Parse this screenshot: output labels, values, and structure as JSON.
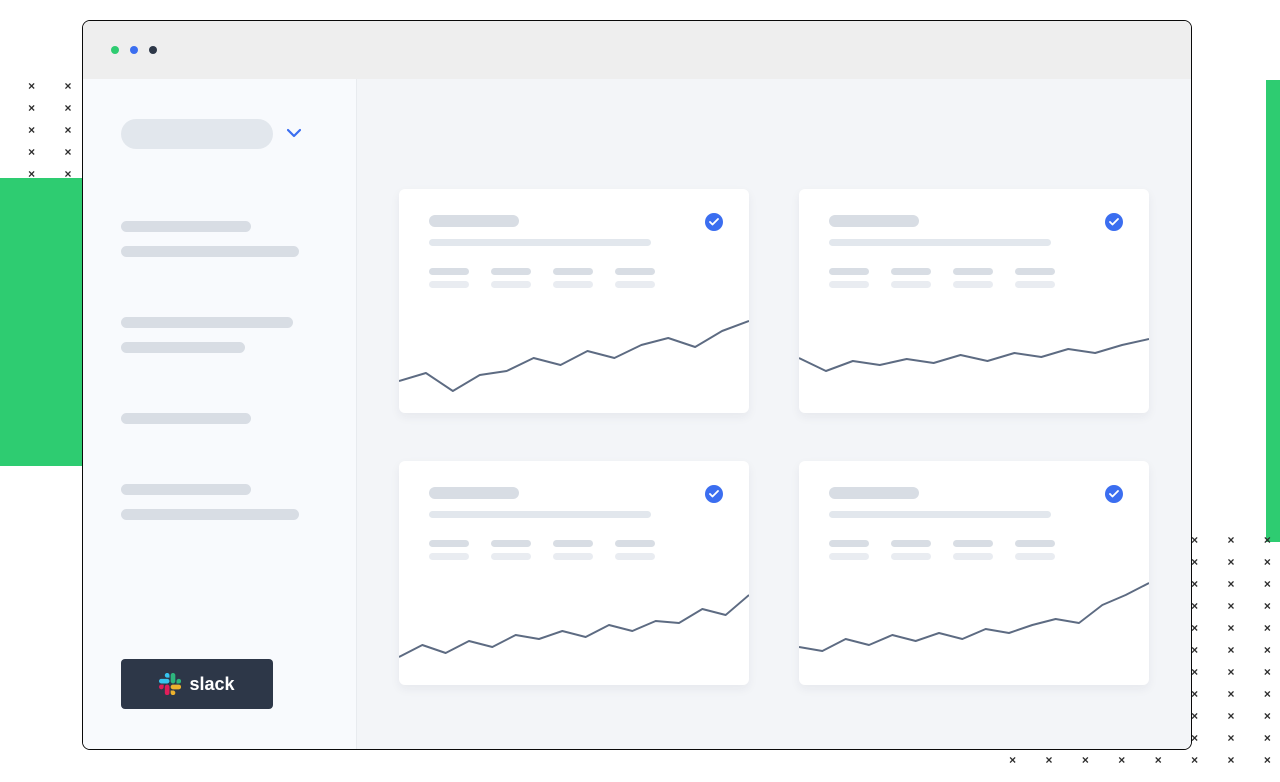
{
  "decor": {
    "x_pattern_tl": "× × × × ×\n× × × × ×\n× × × × ×\n× × × × ×\n× × × × ×\n× × × × ×\n× × × × ×\n× × × × ×\n× × × × ×\n× × × × ×\n× × × × ×\n× × × × ×",
    "x_pattern_br": "× × × × × × × ×\n× × × × × × × ×\n× × × × × × × ×\n× × × × × × × ×\n× × × × × × × ×\n× × × × × × × ×\n× × × × × × × ×\n× × × × × × × ×\n× × × × × × × ×\n× × × × × × × ×\n× × × × × × × ×"
  },
  "sidebar": {
    "slack_label": "slack"
  },
  "colors": {
    "accent": "#3b6ef0",
    "line": "#5d6b82"
  },
  "cards": [
    {
      "spark": [
        78,
        70,
        88,
        72,
        68,
        55,
        62,
        48,
        55,
        42,
        35,
        44,
        28,
        18
      ]
    },
    {
      "spark": [
        55,
        68,
        58,
        62,
        56,
        60,
        52,
        58,
        50,
        54,
        46,
        50,
        42,
        36
      ]
    },
    {
      "spark": [
        82,
        70,
        78,
        66,
        72,
        60,
        64,
        56,
        62,
        50,
        56,
        46,
        48,
        34,
        40,
        20
      ]
    },
    {
      "spark": [
        72,
        76,
        64,
        70,
        60,
        66,
        58,
        64,
        54,
        58,
        50,
        44,
        48,
        30,
        20,
        8
      ]
    }
  ]
}
